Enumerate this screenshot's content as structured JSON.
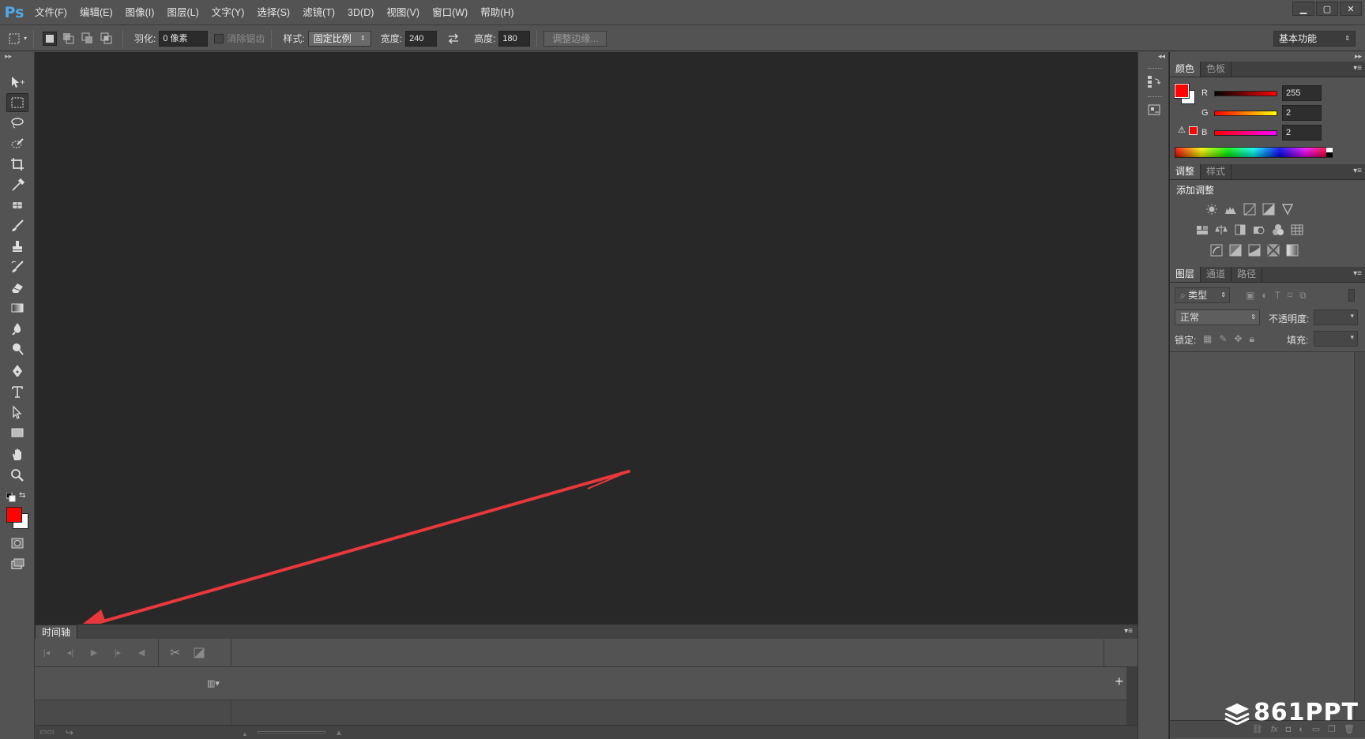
{
  "app": {
    "logo": "Ps"
  },
  "menu": [
    "文件(F)",
    "编辑(E)",
    "图像(I)",
    "图层(L)",
    "文字(Y)",
    "选择(S)",
    "滤镜(T)",
    "3D(D)",
    "视图(V)",
    "窗口(W)",
    "帮助(H)"
  ],
  "options": {
    "feather_label": "羽化:",
    "feather_value": "0 像素",
    "antialias_label": "消除锯齿",
    "style_label": "样式:",
    "style_value": "固定比例",
    "width_label": "宽度:",
    "width_value": "240",
    "height_label": "高度:",
    "height_value": "180",
    "refine_edge": "调整边缘...",
    "workspace": "基本功能"
  },
  "timeline": {
    "tab": "时间轴"
  },
  "color_panel": {
    "tabs": [
      "颜色",
      "色板"
    ],
    "r_label": "R",
    "r_value": "255",
    "g_label": "G",
    "g_value": "2",
    "b_label": "B",
    "b_value": "2",
    "foreground": "#ff0202"
  },
  "adjust_panel": {
    "tabs": [
      "调整",
      "样式"
    ],
    "title": "添加调整"
  },
  "layers_panel": {
    "tabs": [
      "图层",
      "通道",
      "路径"
    ],
    "filter_value": "类型",
    "blend_mode": "正常",
    "opacity_label": "不透明度:",
    "lock_label": "锁定:",
    "fill_label": "填充:"
  },
  "watermark": "861PPT",
  "colors": {
    "accent_red": "#e8383b",
    "ps_blue": "#4fa8e8"
  }
}
